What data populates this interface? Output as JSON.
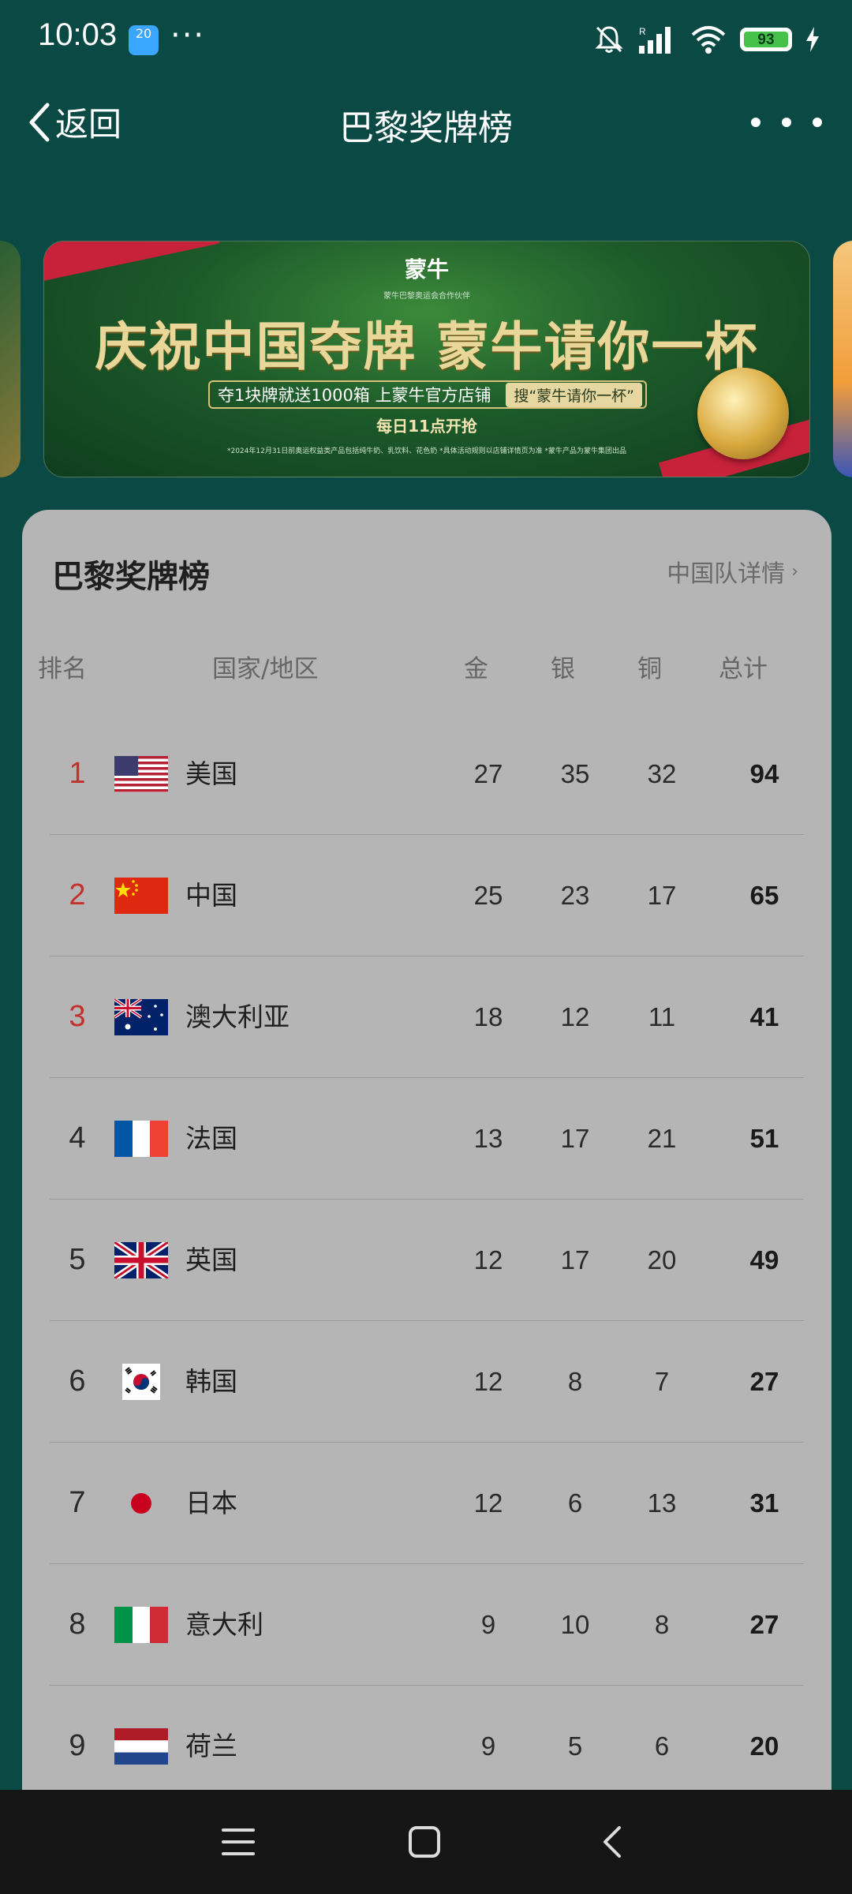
{
  "status_bar": {
    "time": "10:03",
    "notif_badge": "20",
    "battery": "93"
  },
  "header": {
    "back_label": "返回",
    "title": "巴黎奖牌榜"
  },
  "banner": {
    "brand": "蒙牛",
    "sub": "蒙牛巴黎奥运会合作伙伴",
    "headline": "庆祝中国夺牌 蒙牛请你一杯",
    "promo": "夺1块牌就送1000箱 上蒙牛官方店铺",
    "promo_tag": "搜“蒙牛请你一杯”",
    "time": "每日11点开抢",
    "fine_print": "*2024年12月31日前奥运权益类产品包括纯牛奶、乳饮料、花色奶 *具体活动规则以店铺详情页为准 *蒙牛产品为蒙牛集团出品"
  },
  "card": {
    "title": "巴黎奖牌榜",
    "detail_link": "中国队详情",
    "headers": {
      "rank": "排名",
      "country": "国家/地区",
      "gold": "金",
      "silver": "银",
      "bronze": "铜",
      "total": "总计"
    },
    "rows": [
      {
        "rank": "1",
        "country": "美国",
        "flag": "us-flag",
        "gold": "27",
        "silver": "35",
        "bronze": "32",
        "total": "94"
      },
      {
        "rank": "2",
        "country": "中国",
        "flag": "cn-flag",
        "gold": "25",
        "silver": "23",
        "bronze": "17",
        "total": "65"
      },
      {
        "rank": "3",
        "country": "澳大利亚",
        "flag": "au-flag",
        "gold": "18",
        "silver": "12",
        "bronze": "11",
        "total": "41"
      },
      {
        "rank": "4",
        "country": "法国",
        "flag": "fr-flag",
        "gold": "13",
        "silver": "17",
        "bronze": "21",
        "total": "51"
      },
      {
        "rank": "5",
        "country": "英国",
        "flag": "gb-flag",
        "gold": "12",
        "silver": "17",
        "bronze": "20",
        "total": "49"
      },
      {
        "rank": "6",
        "country": "韩国",
        "flag": "kr-flag",
        "gold": "12",
        "silver": "8",
        "bronze": "7",
        "total": "27"
      },
      {
        "rank": "7",
        "country": "日本",
        "flag": "jp-flag",
        "gold": "12",
        "silver": "6",
        "bronze": "13",
        "total": "31"
      },
      {
        "rank": "8",
        "country": "意大利",
        "flag": "it-flag",
        "gold": "9",
        "silver": "10",
        "bronze": "8",
        "total": "27"
      },
      {
        "rank": "9",
        "country": "荷兰",
        "flag": "nl-flag",
        "gold": "9",
        "silver": "5",
        "bronze": "6",
        "total": "20"
      }
    ]
  },
  "colors": {
    "background": "#0b4a44",
    "card": "#b5b5b5",
    "top_rank": "#c4302b"
  }
}
